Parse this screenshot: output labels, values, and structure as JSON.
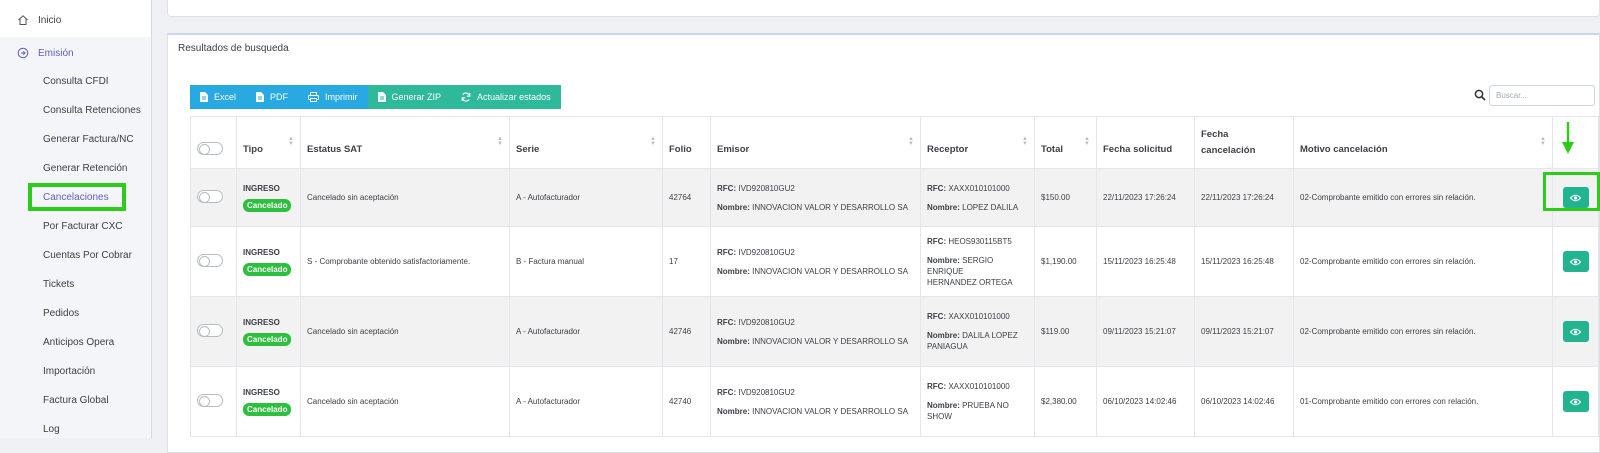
{
  "sidebar": {
    "top": [
      {
        "label": "Inicio",
        "icon": "home-icon"
      },
      {
        "label": "Emisión",
        "icon": "circle-arrow-icon"
      }
    ],
    "items": [
      {
        "label": "Consulta CFDI"
      },
      {
        "label": "Consulta Retenciones"
      },
      {
        "label": "Generar Factura/NC"
      },
      {
        "label": "Generar Retención"
      },
      {
        "label": "Cancelaciones"
      },
      {
        "label": "Por Facturar CXC"
      },
      {
        "label": "Cuentas Por Cobrar"
      },
      {
        "label": "Tickets"
      },
      {
        "label": "Pedidos"
      },
      {
        "label": "Anticipos Opera"
      },
      {
        "label": "Importación"
      },
      {
        "label": "Factura Global"
      },
      {
        "label": "Log"
      }
    ]
  },
  "results": {
    "title": "Resultados de busqueda",
    "toolbar": {
      "excel": "Excel",
      "pdf": "PDF",
      "print": "Imprimir",
      "zip": "Generar ZIP",
      "update": "Actualizar estados"
    },
    "search_placeholder": "Buscar..."
  },
  "table": {
    "headers": {
      "tipo": "Tipo",
      "estatus": "Estatus SAT",
      "serie": "Serie",
      "folio": "Folio",
      "emisor": "Emisor",
      "receptor": "Receptor",
      "total": "Total",
      "fecha_solicitud": "Fecha solicitud",
      "fecha_cancelacion_1": "Fecha",
      "fecha_cancelacion_2": "cancelación",
      "motivo": "Motivo cancelación"
    },
    "labels": {
      "rfc": "RFC:",
      "nombre": "Nombre:"
    },
    "rows": [
      {
        "tipo": "INGRESO",
        "badge": "Cancelado",
        "estatus": "Cancelado sin aceptación",
        "serie": "A - Autofacturador",
        "folio": "42764",
        "emisor_rfc": "IVD920810GU2",
        "emisor_nombre": "INNOVACION VALOR Y DESARROLLO SA",
        "receptor_rfc": "XAXX010101000",
        "receptor_nombre": "LOPEZ DALILA",
        "total": "$150.00",
        "fecha_solicitud": "22/11/2023 17:26:24",
        "fecha_cancelacion": "22/11/2023 17:26:24",
        "motivo": "02-Comprobante emitido con errores sin relación."
      },
      {
        "tipo": "INGRESO",
        "badge": "Cancelado",
        "estatus": "S - Comprobante obtenido satisfactoriamente.",
        "serie": "B - Factura manual",
        "folio": "17",
        "emisor_rfc": "IVD920810GU2",
        "emisor_nombre": "INNOVACION VALOR Y DESARROLLO SA",
        "receptor_rfc": "HEOS930115BT5",
        "receptor_nombre": "SERGIO ENRIQUE",
        "receptor_nombre_2": "HERNANDEZ ORTEGA",
        "total": "$1,190.00",
        "fecha_solicitud": "15/11/2023 16:25:48",
        "fecha_cancelacion": "15/11/2023 16:25:48",
        "motivo": "02-Comprobante emitido con errores sin relación."
      },
      {
        "tipo": "INGRESO",
        "badge": "Cancelado",
        "estatus": "Cancelado sin aceptación",
        "serie": "A - Autofacturador",
        "folio": "42746",
        "emisor_rfc": "IVD920810GU2",
        "emisor_nombre": "INNOVACION VALOR Y DESARROLLO SA",
        "receptor_rfc": "XAXX010101000",
        "receptor_nombre": "DALILA LOPEZ",
        "receptor_nombre_2": "PANIAGUA",
        "total": "$119.00",
        "fecha_solicitud": "09/11/2023 15:21:07",
        "fecha_cancelacion": "09/11/2023 15:21:07",
        "motivo": "02-Comprobante emitido con errores sin relación."
      },
      {
        "tipo": "INGRESO",
        "badge": "Cancelado",
        "estatus": "Cancelado sin aceptación",
        "serie": "A - Autofacturador",
        "folio": "42740",
        "emisor_rfc": "IVD920810GU2",
        "emisor_nombre": "INNOVACION VALOR Y DESARROLLO SA",
        "receptor_rfc": "XAXX010101000",
        "receptor_nombre": "PRUEBA NO",
        "receptor_nombre_2": "SHOW",
        "total": "$2,380.00",
        "fecha_solicitud": "06/10/2023 14:02:46",
        "fecha_cancelacion": "06/10/2023 14:02:46",
        "motivo": "01-Comprobante emitido con errores con relación."
      }
    ]
  },
  "colors": {
    "highlight": "#2ecc1a",
    "btn_blue": "#29a9e1",
    "btn_green": "#2db99a",
    "badge": "#2ebf3f",
    "view_button": "#23b38e",
    "active_nav": "#5e5ec0"
  }
}
